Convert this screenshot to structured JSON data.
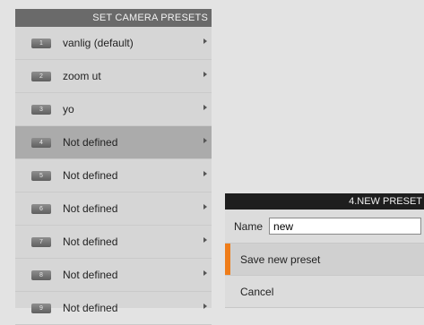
{
  "presets_panel": {
    "title": "SET CAMERA PRESETS",
    "items": [
      {
        "num": "1",
        "label": "vanlig (default)",
        "selected": false
      },
      {
        "num": "2",
        "label": "zoom ut",
        "selected": false
      },
      {
        "num": "3",
        "label": "yo",
        "selected": false
      },
      {
        "num": "4",
        "label": "Not defined",
        "selected": true
      },
      {
        "num": "5",
        "label": "Not defined",
        "selected": false
      },
      {
        "num": "6",
        "label": "Not defined",
        "selected": false
      },
      {
        "num": "7",
        "label": "Not defined",
        "selected": false
      },
      {
        "num": "8",
        "label": "Not defined",
        "selected": false
      },
      {
        "num": "9",
        "label": "Not defined",
        "selected": false
      }
    ]
  },
  "dialog": {
    "title": "4.NEW PRESET",
    "name_label": "Name",
    "name_value": "new",
    "save_label": "Save new preset",
    "cancel_label": "Cancel"
  },
  "colors": {
    "accent": "#ef7d1a"
  }
}
